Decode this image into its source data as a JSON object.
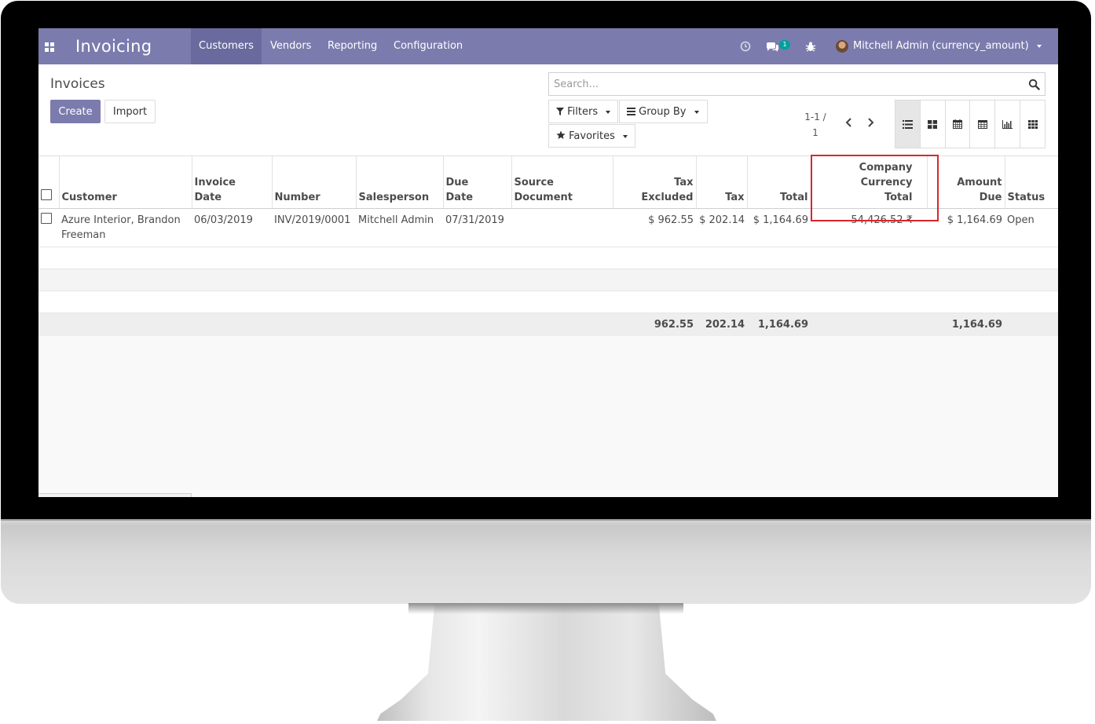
{
  "navbar": {
    "app_title": "Invoicing",
    "menu": [
      "Customers",
      "Vendors",
      "Reporting",
      "Configuration"
    ],
    "active_menu": "Customers",
    "chat_badge": "1",
    "user": "Mitchell Admin (currency_amount)",
    "brand_color": "#7c7bad"
  },
  "control_panel": {
    "breadcrumb": "Invoices",
    "create_label": "Create",
    "import_label": "Import",
    "search_placeholder": "Search...",
    "filters_label": "Filters",
    "group_by_label": "Group By",
    "favorites_label": "Favorites",
    "pager_range": "1-1 /",
    "pager_total": "1",
    "views": [
      "list",
      "kanban",
      "calendar",
      "pivot",
      "graph",
      "grid"
    ],
    "active_view": "list"
  },
  "table": {
    "headers": {
      "customer": "Customer",
      "invoice_date_1": "Invoice",
      "invoice_date_2": "Date",
      "number": "Number",
      "salesperson": "Salesperson",
      "due_date_1": "Due",
      "due_date_2": "Date",
      "source_1": "Source",
      "source_2": "Document",
      "tax_excl_1": "Tax",
      "tax_excl_2": "Excluded",
      "tax": "Tax",
      "total": "Total",
      "company_total_1": "Company Currency",
      "company_total_2": "Total",
      "amount_due_1": "Amount",
      "amount_due_2": "Due",
      "status": "Status"
    },
    "rows": [
      {
        "customer": "Azure Interior, Brandon Freeman",
        "invoice_date": "06/03/2019",
        "number": "INV/2019/0001",
        "salesperson": "Mitchell Admin",
        "due_date": "07/31/2019",
        "source_document": "",
        "tax_excluded": "$ 962.55",
        "tax": "$ 202.14",
        "total": "$ 1,164.69",
        "company_currency_total": "54,426.52 ₹",
        "amount_due": "$ 1,164.69",
        "status": "Open"
      }
    ],
    "totals": {
      "tax_excluded": "962.55",
      "tax": "202.14",
      "total": "1,164.69",
      "amount_due": "1,164.69"
    },
    "highlight_color": "#d9262c"
  }
}
